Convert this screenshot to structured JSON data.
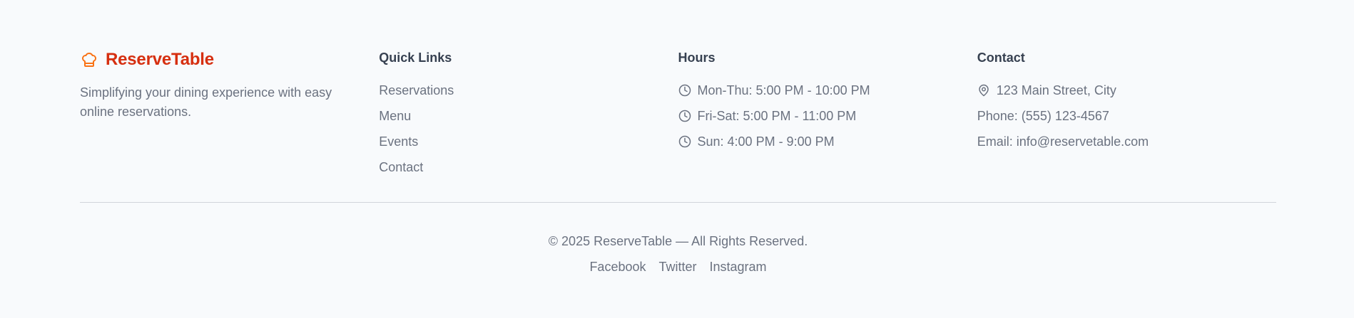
{
  "brand": {
    "name": "ReserveTable",
    "tagline": "Simplifying your dining experience with easy online reservations.",
    "icon": "chef-hat-icon",
    "color": "#d62f10",
    "icon_color": "#f97316"
  },
  "quick_links": {
    "title": "Quick Links",
    "items": [
      "Reservations",
      "Menu",
      "Events",
      "Contact"
    ]
  },
  "hours": {
    "title": "Hours",
    "items": [
      "Mon-Thu: 5:00 PM - 10:00 PM",
      "Fri-Sat: 5:00 PM - 11:00 PM",
      "Sun: 4:00 PM - 9:00 PM"
    ],
    "icon": "clock-icon"
  },
  "contact": {
    "title": "Contact",
    "address": "123 Main Street, City",
    "address_icon": "map-pin-icon",
    "phone": "Phone: (555) 123-4567",
    "email": "Email: info@reservetable.com"
  },
  "footer_bottom": {
    "copyright": "© 2025 ReserveTable — All Rights Reserved.",
    "social": [
      "Facebook",
      "Twitter",
      "Instagram"
    ]
  },
  "colors": {
    "background": "#f8fafc",
    "heading": "#374151",
    "text": "#6b7280",
    "divider": "#d1d5db"
  }
}
